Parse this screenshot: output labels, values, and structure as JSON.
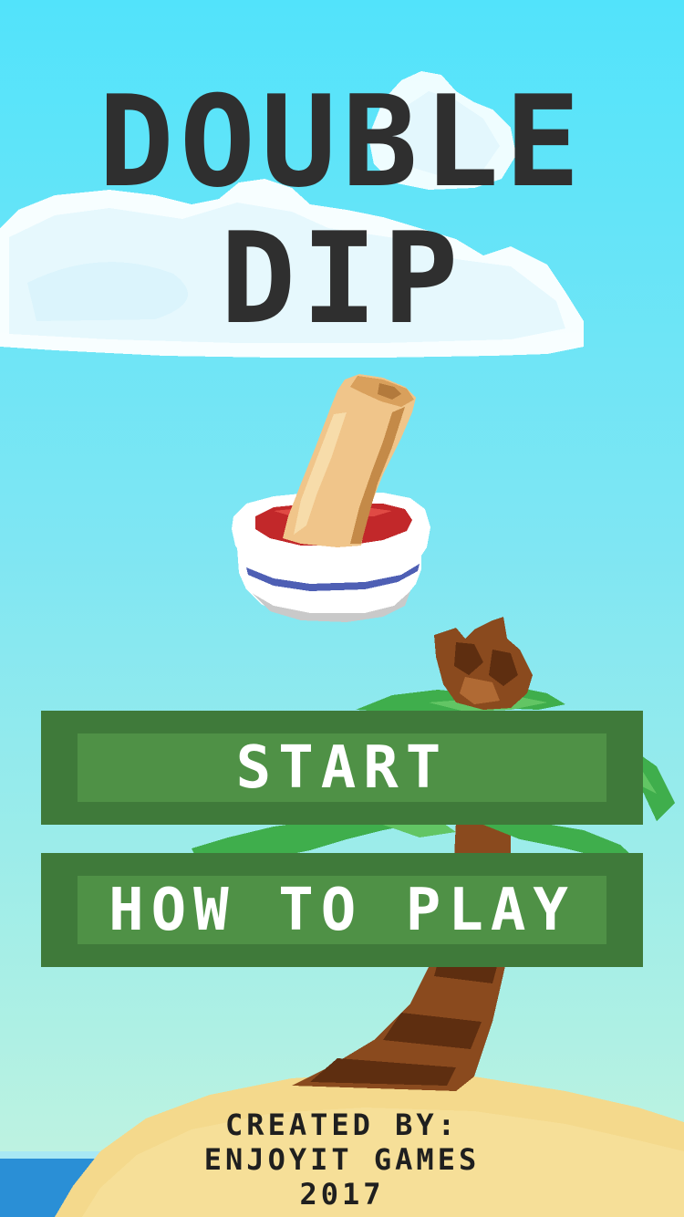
{
  "app": {
    "title_line_1": "DOUBLE",
    "title_line_2": "DIP"
  },
  "menu": {
    "start_label": "START",
    "how_to_play_label": "HOW TO PLAY"
  },
  "credits": {
    "line_1": "CREATED BY:",
    "line_2": "ENJOYIT GAMES",
    "line_3": "2017"
  },
  "colors": {
    "sky_top": "#52e3fb",
    "sky_bottom": "#c6f4df",
    "title_text": "#2f2f2f",
    "button_outer": "#3f7a3a",
    "button_inner": "#4f9146",
    "button_text": "#ffffff",
    "sand": "#f4d98c",
    "sea": "#2a8fd6"
  },
  "icons": {
    "spring_roll": "spring-roll-in-dip-bowl",
    "palm_tree": "palm-tree",
    "cloud": "cloud",
    "island": "sand-island"
  }
}
